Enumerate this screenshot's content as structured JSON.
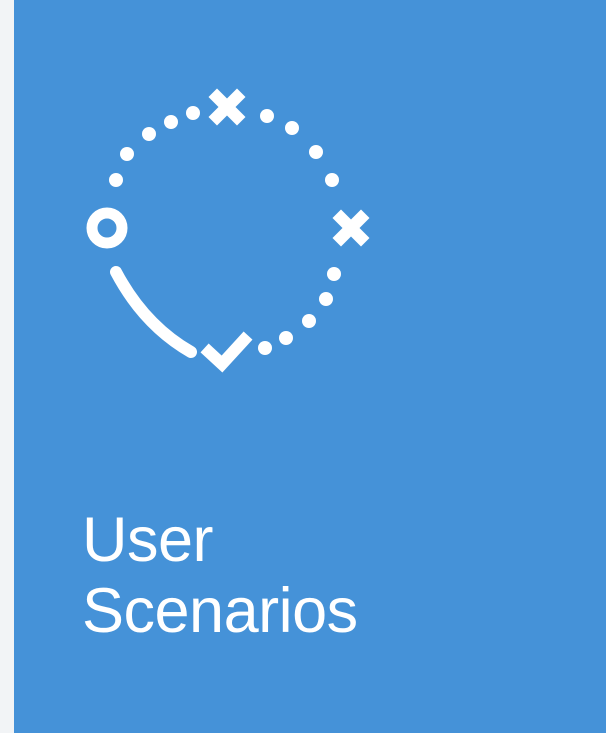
{
  "tile": {
    "label_line1": "User",
    "label_line2": "Scenarios",
    "icon": "user-scenarios-journey-icon",
    "background_color": "#4592d8",
    "foreground_color": "#ffffff"
  }
}
